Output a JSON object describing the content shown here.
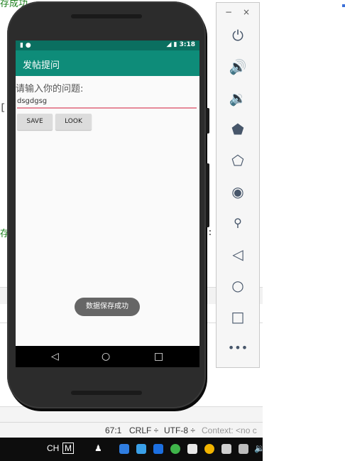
{
  "ide": {
    "top_fragment": "存成功",
    "mid_fragment": "存",
    "bracket_fragment": "[ ;",
    "colon_fragment": ":"
  },
  "statusbar": {
    "position": "67:1",
    "line_sep": "CRLF ÷",
    "encoding": "UTF-8 ÷",
    "context": "Context: <no c"
  },
  "taskbar": {
    "lang": "CH",
    "ime": "M"
  },
  "phone": {
    "status_time": "3:18",
    "app_title": "发帖提问",
    "prompt": "请输入你的问题:",
    "input_value": "dsgdgsg",
    "save_label": "SAVE",
    "look_label": "LOOK",
    "toast": "数据保存成功"
  },
  "emulator": {
    "minimize": "−",
    "close": "×",
    "buttons": [
      "power-icon",
      "volume-up-icon",
      "volume-down-icon",
      "rotate-left-icon",
      "rotate-right-icon",
      "camera-icon",
      "zoom-icon",
      "back-icon",
      "home-icon",
      "overview-icon",
      "more-icon"
    ]
  }
}
